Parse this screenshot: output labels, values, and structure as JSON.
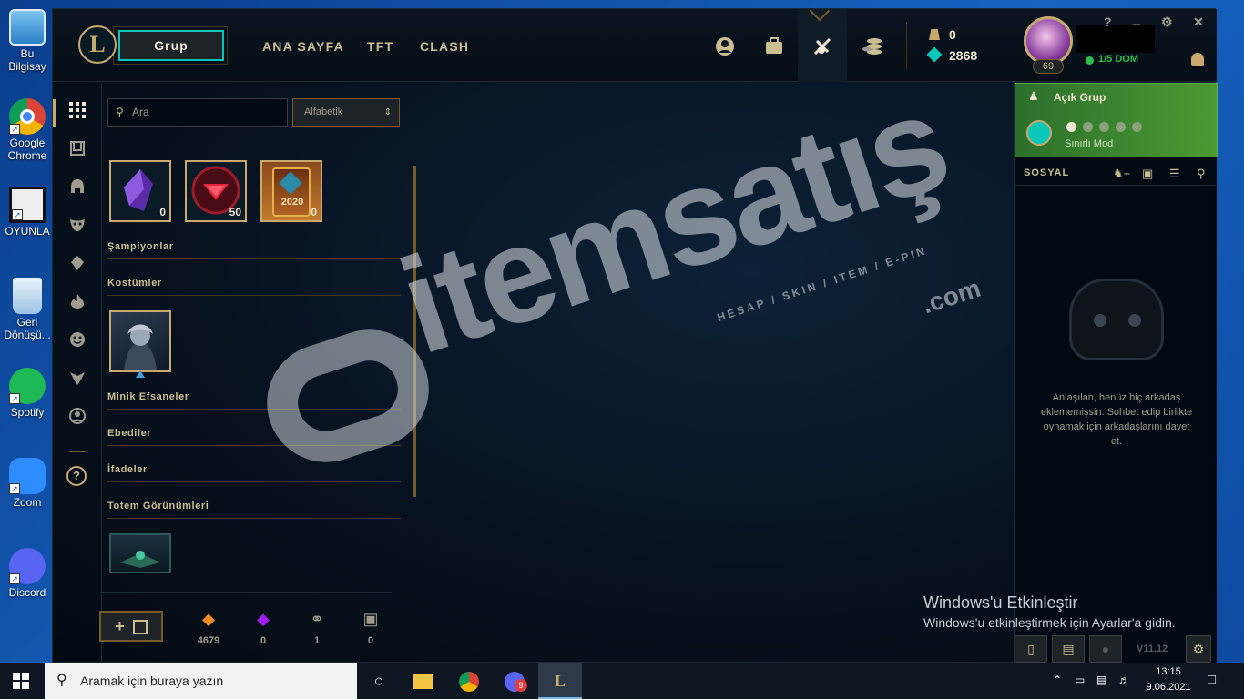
{
  "desktop": {
    "icons": [
      {
        "label": "Bu Bilgisay",
        "name": "computer"
      },
      {
        "label": "Google Chrome",
        "name": "chrome"
      },
      {
        "label": "OYUNLA",
        "name": "games-shortcut"
      },
      {
        "label": "Geri Dönüşü...",
        "name": "recycle-bin"
      },
      {
        "label": "Spotify",
        "name": "spotify"
      },
      {
        "label": "Zoom",
        "name": "zoom"
      },
      {
        "label": "Discord",
        "name": "discord"
      }
    ]
  },
  "client": {
    "logo": "L",
    "group_button": "Grup",
    "nav": [
      "ANA SAYFA",
      "TFT",
      "CLASH"
    ],
    "currency": {
      "rp": "0",
      "blue_essence": "2868"
    },
    "profile": {
      "level": "69",
      "status": "1/5 DOM"
    },
    "window_controls": [
      "?",
      "_",
      "⚙",
      "✕"
    ],
    "search": {
      "placeholder": "Ara"
    },
    "sort": {
      "selected": "Alfabetik"
    },
    "loot_tiles": [
      {
        "name": "purple-crystal",
        "count": "0"
      },
      {
        "name": "red-gem-orb",
        "count": "50"
      },
      {
        "name": "card-2020",
        "count": "0",
        "label": "2020"
      }
    ],
    "sections": {
      "champions": "Şampiyonlar",
      "skins": "Kostümler",
      "little_legends": "Minik Efsaneler",
      "eternals": "Ebediler",
      "emotes": "İfadeler",
      "ward_skins": "Totem Görünümleri"
    },
    "bottom_currencies": [
      {
        "name": "orange-essence",
        "value": "4679",
        "color": "#f08a24"
      },
      {
        "name": "mythic-essence",
        "value": "0",
        "color": "#a020f0"
      },
      {
        "name": "key-fragment",
        "value": "1",
        "color": "#a09b8c"
      },
      {
        "name": "chest",
        "value": "0",
        "color": "#a09b8c"
      }
    ],
    "add_button": "+",
    "party": {
      "title": "Açık Grup",
      "mode": "Sınırlı Mod"
    },
    "social": {
      "title": "SOSYAL",
      "empty_text": "Anlaşılan, henüz hiç arkadaş eklememişsin. Sohbet edip birlikte oynamak için arkadaşlarını davet et."
    },
    "version": "V11.12"
  },
  "watermark": {
    "brand": "itemsatış",
    "suffix": ".com",
    "tagline": "HESAP / SKIN / ITEM / E-PIN"
  },
  "activation": {
    "title": "Windows'u Etkinleştir",
    "subtitle": "Windows'u etkinleştirmek için Ayarlar'a gidin."
  },
  "taskbar": {
    "search_placeholder": "Aramak için buraya yazın",
    "time": "13:15",
    "date": "9.06.2021",
    "badge": "9"
  }
}
